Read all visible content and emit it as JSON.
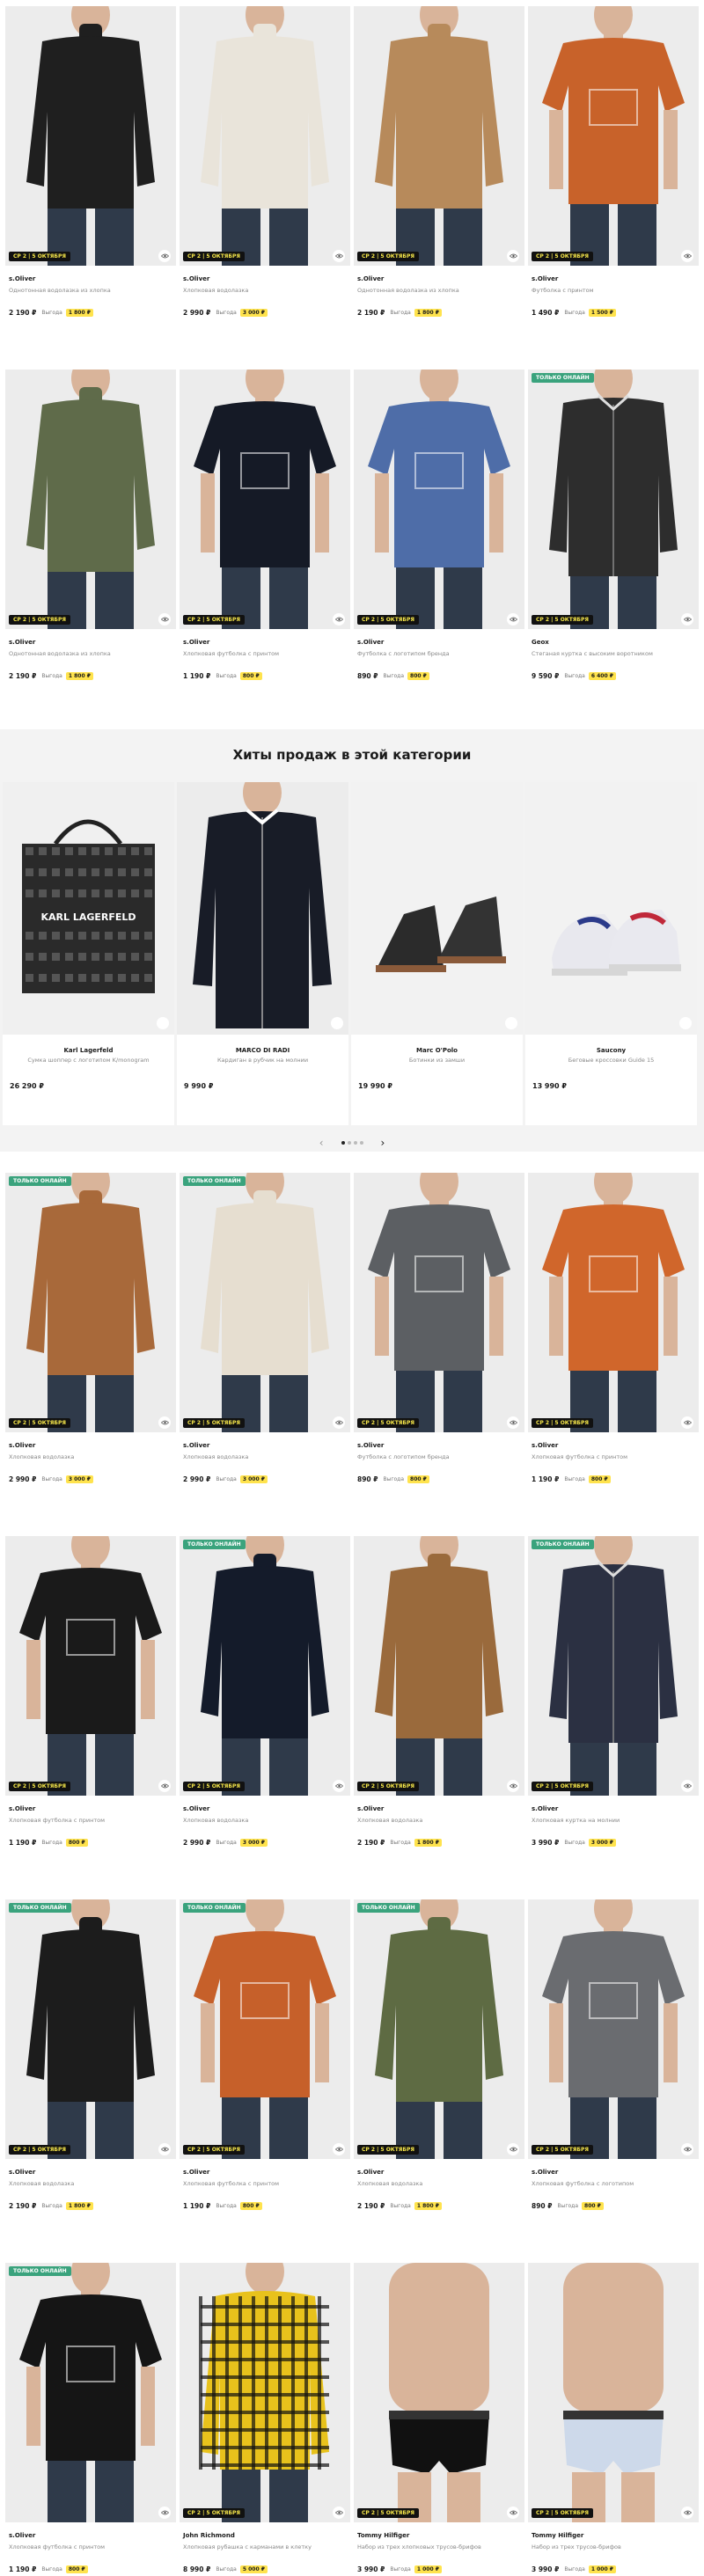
{
  "row1": [
    {
      "brand": "s.Oliver",
      "name": "Однотонная водолазка из хлопка",
      "price": "2 190 ₽",
      "save_label": "Выгода",
      "save": "1 800 ₽",
      "badge_date": "СР 2 | 5 ОКТЯБРЯ",
      "online": ""
    },
    {
      "brand": "s.Oliver",
      "name": "Хлопковая водолазка",
      "price": "2 990 ₽",
      "save_label": "Выгода",
      "save": "3 000 ₽",
      "badge_date": "СР 2 | 5 ОКТЯБРЯ",
      "online": ""
    },
    {
      "brand": "s.Oliver",
      "name": "Однотонная водолазка из хлопка",
      "price": "2 190 ₽",
      "save_label": "Выгода",
      "save": "1 800 ₽",
      "badge_date": "СР 2 | 5 ОКТЯБРЯ",
      "online": ""
    },
    {
      "brand": "s.Oliver",
      "name": "Футболка с принтом",
      "price": "1 490 ₽",
      "save_label": "Выгода",
      "save": "1 500 ₽",
      "badge_date": "СР 2 | 5 ОКТЯБРЯ",
      "online": ""
    }
  ],
  "row2": [
    {
      "brand": "s.Oliver",
      "name": "Однотонная водолазка из хлопка",
      "price": "2 190 ₽",
      "save_label": "Выгода",
      "save": "1 800 ₽",
      "badge_date": "СР 2 | 5 ОКТЯБРЯ",
      "online": ""
    },
    {
      "brand": "s.Oliver",
      "name": "Хлопковая футболка с принтом",
      "price": "1 190 ₽",
      "save_label": "Выгода",
      "save": "800 ₽",
      "badge_date": "СР 2 | 5 ОКТЯБРЯ",
      "online": ""
    },
    {
      "brand": "s.Oliver",
      "name": "Футболка с логотипом бренда",
      "price": "890 ₽",
      "save_label": "Выгода",
      "save": "800 ₽",
      "badge_date": "СР 2 | 5 ОКТЯБРЯ",
      "online": ""
    },
    {
      "brand": "Geox",
      "name": "Стеганая куртка с высоким воротником",
      "price": "9 590 ₽",
      "save_label": "Выгода",
      "save": "6 400 ₽",
      "badge_date": "СР 2 | 5 ОКТЯБРЯ",
      "online": "ТОЛЬКО ОНЛАЙН"
    }
  ],
  "hits": {
    "title": "Хиты продаж в этой категории",
    "items": [
      {
        "brand": "Karl Lagerfeld",
        "name": "Сумка шоппер с логотипом K/monogram",
        "price": "26 290 ₽",
        "bag_text": "KARL LAGERFELD"
      },
      {
        "brand": "MARCO DI RADI",
        "name": "Кардиган в рубчик на молнии",
        "price": "9 990 ₽"
      },
      {
        "brand": "Marc O'Polo",
        "name": "Ботинки из замши",
        "price": "19 990 ₽"
      },
      {
        "brand": "Saucony",
        "name": "Беговые кроссовки Guide 15",
        "price": "13 990 ₽"
      }
    ],
    "prev_icon": "‹",
    "next_icon": "›"
  },
  "row3": [
    {
      "brand": "s.Oliver",
      "name": "Хлопковая водолазка",
      "price": "2 990 ₽",
      "save_label": "Выгода",
      "save": "3 000 ₽",
      "badge_date": "СР 2 | 5 ОКТЯБРЯ",
      "online": "ТОЛЬКО ОНЛАЙН"
    },
    {
      "brand": "s.Oliver",
      "name": "Хлопковая водолазка",
      "price": "2 990 ₽",
      "save_label": "Выгода",
      "save": "3 000 ₽",
      "badge_date": "СР 2 | 5 ОКТЯБРЯ",
      "online": "ТОЛЬКО ОНЛАЙН"
    },
    {
      "brand": "s.Oliver",
      "name": "Футболка с логотипом бренда",
      "price": "890 ₽",
      "save_label": "Выгода",
      "save": "800 ₽",
      "badge_date": "СР 2 | 5 ОКТЯБРЯ",
      "online": ""
    },
    {
      "brand": "s.Oliver",
      "name": "Хлопковая футболка с принтом",
      "price": "1 190 ₽",
      "save_label": "Выгода",
      "save": "800 ₽",
      "badge_date": "СР 2 | 5 ОКТЯБРЯ",
      "online": ""
    }
  ],
  "row4": [
    {
      "brand": "s.Oliver",
      "name": "Хлопковая футболка с принтом",
      "price": "1 190 ₽",
      "save_label": "Выгода",
      "save": "800 ₽",
      "badge_date": "СР 2 | 5 ОКТЯБРЯ",
      "online": ""
    },
    {
      "brand": "s.Oliver",
      "name": "Хлопковая водолазка",
      "price": "2 990 ₽",
      "save_label": "Выгода",
      "save": "3 000 ₽",
      "badge_date": "СР 2 | 5 ОКТЯБРЯ",
      "online": "ТОЛЬКО ОНЛАЙН"
    },
    {
      "brand": "s.Oliver",
      "name": "Хлопковая водолазка",
      "price": "2 190 ₽",
      "save_label": "Выгода",
      "save": "1 800 ₽",
      "badge_date": "СР 2 | 5 ОКТЯБРЯ",
      "online": ""
    },
    {
      "brand": "s.Oliver",
      "name": "Хлопковая куртка на молнии",
      "price": "3 990 ₽",
      "save_label": "Выгода",
      "save": "3 000 ₽",
      "badge_date": "СР 2 | 5 ОКТЯБРЯ",
      "online": "ТОЛЬКО ОНЛАЙН"
    }
  ],
  "row5": [
    {
      "brand": "s.Oliver",
      "name": "Хлопковая водолазка",
      "price": "2 190 ₽",
      "save_label": "Выгода",
      "save": "1 800 ₽",
      "badge_date": "СР 2 | 5 ОКТЯБРЯ",
      "online": "ТОЛЬКО ОНЛАЙН"
    },
    {
      "brand": "s.Oliver",
      "name": "Хлопковая футболка с принтом",
      "price": "1 190 ₽",
      "save_label": "Выгода",
      "save": "800 ₽",
      "badge_date": "СР 2 | 5 ОКТЯБРЯ",
      "online": "ТОЛЬКО ОНЛАЙН"
    },
    {
      "brand": "s.Oliver",
      "name": "Хлопковая водолазка",
      "price": "2 190 ₽",
      "save_label": "Выгода",
      "save": "1 800 ₽",
      "badge_date": "СР 2 | 5 ОКТЯБРЯ",
      "online": "ТОЛЬКО ОНЛАЙН"
    },
    {
      "brand": "s.Oliver",
      "name": "Хлопковая футболка с логотипом",
      "price": "890 ₽",
      "save_label": "Выгода",
      "save": "800 ₽",
      "badge_date": "СР 2 | 5 ОКТЯБРЯ",
      "online": ""
    }
  ],
  "row6": [
    {
      "brand": "s.Oliver",
      "name": "Хлопковая футболка с принтом",
      "price": "1 190 ₽",
      "save_label": "Выгода",
      "save": "800 ₽",
      "badge_date": "",
      "online": "ТОЛЬКО ОНЛАЙН"
    },
    {
      "brand": "John Richmond",
      "name": "Хлопковая рубашка с карманами в клетку",
      "price": "8 990 ₽",
      "save_label": "Выгода",
      "save": "5 000 ₽",
      "badge_date": "СР 2 | 5 ОКТЯБРЯ",
      "online": ""
    },
    {
      "brand": "Tommy Hilfiger",
      "name": "Набор из трех хлопковых трусов-брифов",
      "price": "3 990 ₽",
      "save_label": "Выгода",
      "save": "1 000 ₽",
      "badge_date": "СР 2 | 5 ОКТЯБРЯ",
      "online": ""
    },
    {
      "brand": "Tommy Hilfiger",
      "name": "Набор из трех трусов-брифов",
      "price": "3 990 ₽",
      "save_label": "Выгода",
      "save": "1 000 ₽",
      "badge_date": "СР 2 | 5 ОКТЯБРЯ",
      "online": ""
    }
  ],
  "colors": {
    "online_badge": "#3aa37d",
    "date_badge_bg": "#111111",
    "date_badge_text": "#f5e64a",
    "save_bg": "#ffe34d"
  },
  "icons": {
    "eye": "eye-icon",
    "prev": "chevron-left-icon",
    "next": "chevron-right-icon"
  }
}
